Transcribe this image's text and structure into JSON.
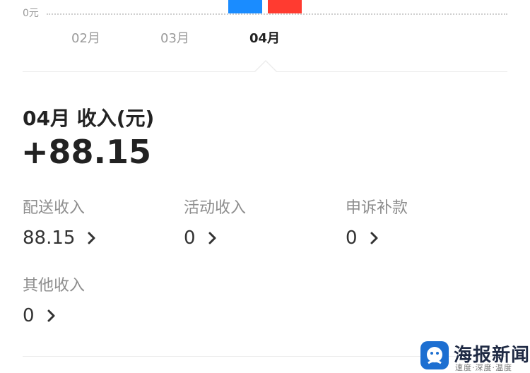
{
  "chart": {
    "zero_label": "0元",
    "months": [
      "02月",
      "03月",
      "04月"
    ],
    "selected_month": "04月",
    "bar_colors": [
      "#1a8cff",
      "#ff3b30"
    ]
  },
  "summary": {
    "title": "04月 收入(元)",
    "total": "+88.15"
  },
  "breakdown": [
    {
      "label": "配送收入",
      "value": "88.15",
      "icon": "chevron-right-icon"
    },
    {
      "label": "活动收入",
      "value": "0",
      "icon": "chevron-right-icon"
    },
    {
      "label": "申诉补款",
      "value": "0",
      "icon": "chevron-right-icon"
    },
    {
      "label": "其他收入",
      "value": "0",
      "icon": "chevron-right-icon"
    }
  ],
  "watermark": {
    "name": "海报新闻",
    "slogan": "速度·深度·温度"
  }
}
